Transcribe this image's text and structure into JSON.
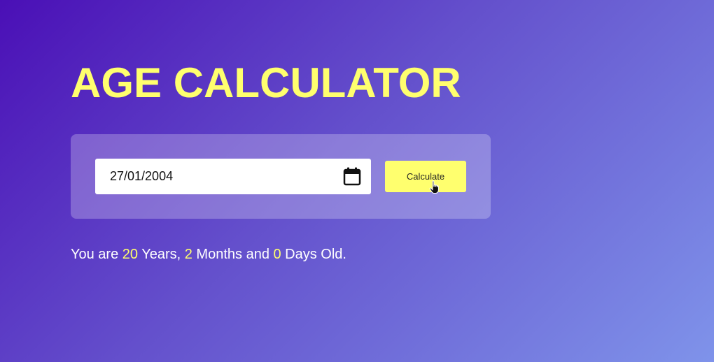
{
  "header": {
    "title": "AGE CALCULATOR"
  },
  "form": {
    "date_value": "27/01/2004",
    "calendar_icon": "calendar-icon",
    "calculate_label": "Calculate"
  },
  "result": {
    "prefix": "You are ",
    "years": "20",
    "years_label": " Years, ",
    "months": "2",
    "months_label": " Months and ",
    "days": "0",
    "days_label": " Days Old."
  },
  "colors": {
    "accent": "#ffff6e",
    "background_start": "#4a0fb6",
    "background_end": "#7f93ea"
  }
}
